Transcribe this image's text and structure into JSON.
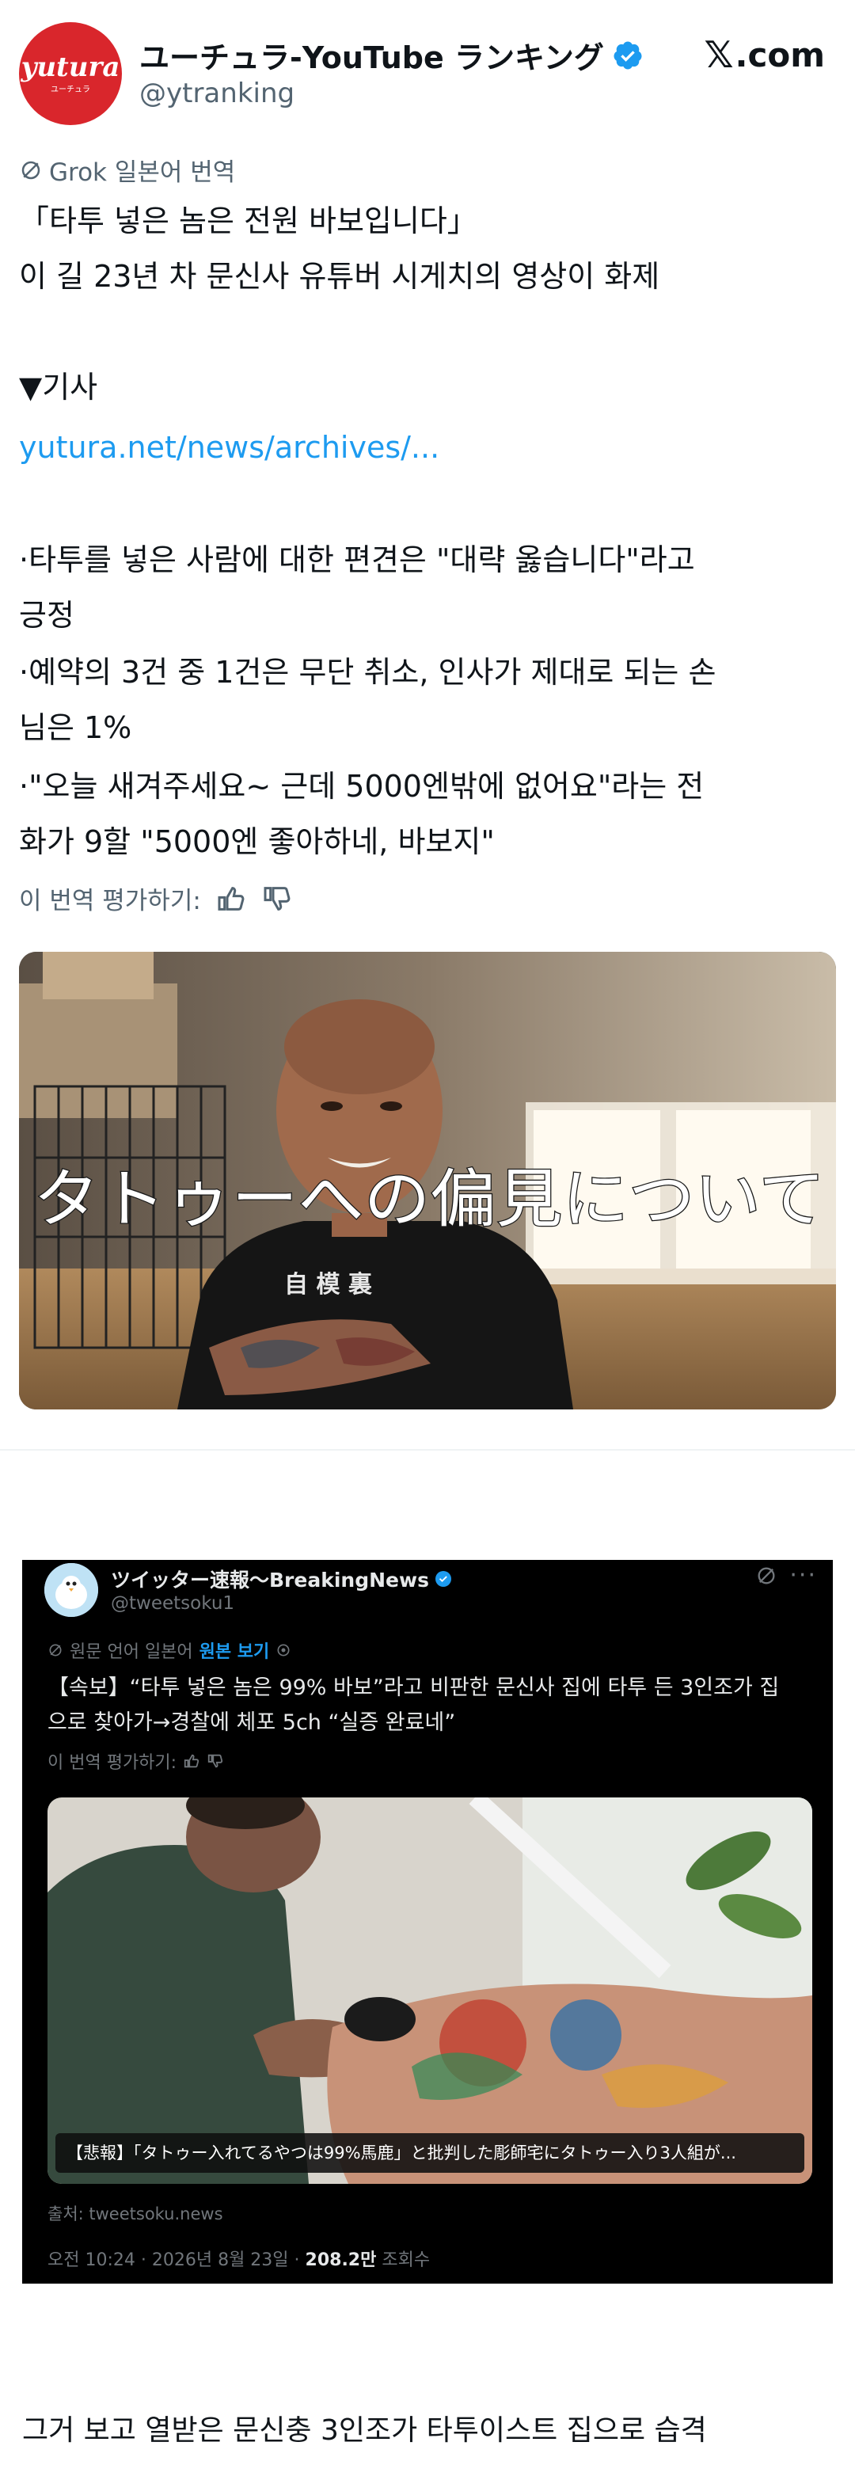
{
  "post": {
    "avatar_text_main": "yutura",
    "avatar_text_sub": "ユーチュラ",
    "account_name": "ユーチュラ-YouTube ランキング",
    "handle": "@ytranking",
    "site_label": ".com",
    "grok_label": "Grok 일본어 번역",
    "lines": [
      "「타투 넣은 놈은 전원 바보입니다」",
      "이 길 23년 차 문신사 유튜버 시게치의 영상이 화제",
      "▼기사",
      "yutura.net/news/archives/...",
      "·타투를 넣은 사람에 대한 편견은 \"대략 옳습니다\"라고",
      "긍정",
      "·예약의 3건 중 1건은 무단 취소, 인사가 제대로 되는 손",
      "님은 1%",
      "·\"오늘 새겨주세요~ 근데 5000엔밖에 없어요\"라는 전",
      "화가 9할 \"5000엔 좋아하네, 바보지\""
    ],
    "rate_label": "이 번역 평가하기:",
    "image_caption": "タトゥーへの偏見について",
    "shirt_text": "自 模 裏"
  },
  "embed": {
    "account_name": "ツイッター速報〜BreakingNews",
    "handle": "@tweetsoku1",
    "original_label": "원문 언어 일본어",
    "view_original": "원본 보기",
    "text_lines": [
      "【속보】“타투 넣은 놈은 99% 바보”라고 비판한 문신사 집에 타투 든 3인조가 집",
      "으로 찾아가→경찰에 체포 5ch “실증 완료네”"
    ],
    "rate_label": "이 번역 평가하기:",
    "image_caption": "【悲報】「タトゥー入れてるやつは99%馬鹿」と批判した彫師宅にタトゥー入り3人組が...",
    "source": "출처: tweetsoku.news",
    "time": "오전 10:24 · 2026년 8월 23일 · ",
    "views": "208.2만",
    "views_label": " 조회수"
  },
  "footer": {
    "text": "그거 보고 열받은 문신충 3인조가 타투이스트 집으로 습격"
  },
  "colors": {
    "brand_red": "#d9262c",
    "link_blue": "#1d9bf0",
    "verified_blue": "#1d9bf0",
    "muted_gray": "#536471",
    "dark_bg": "#000000"
  }
}
